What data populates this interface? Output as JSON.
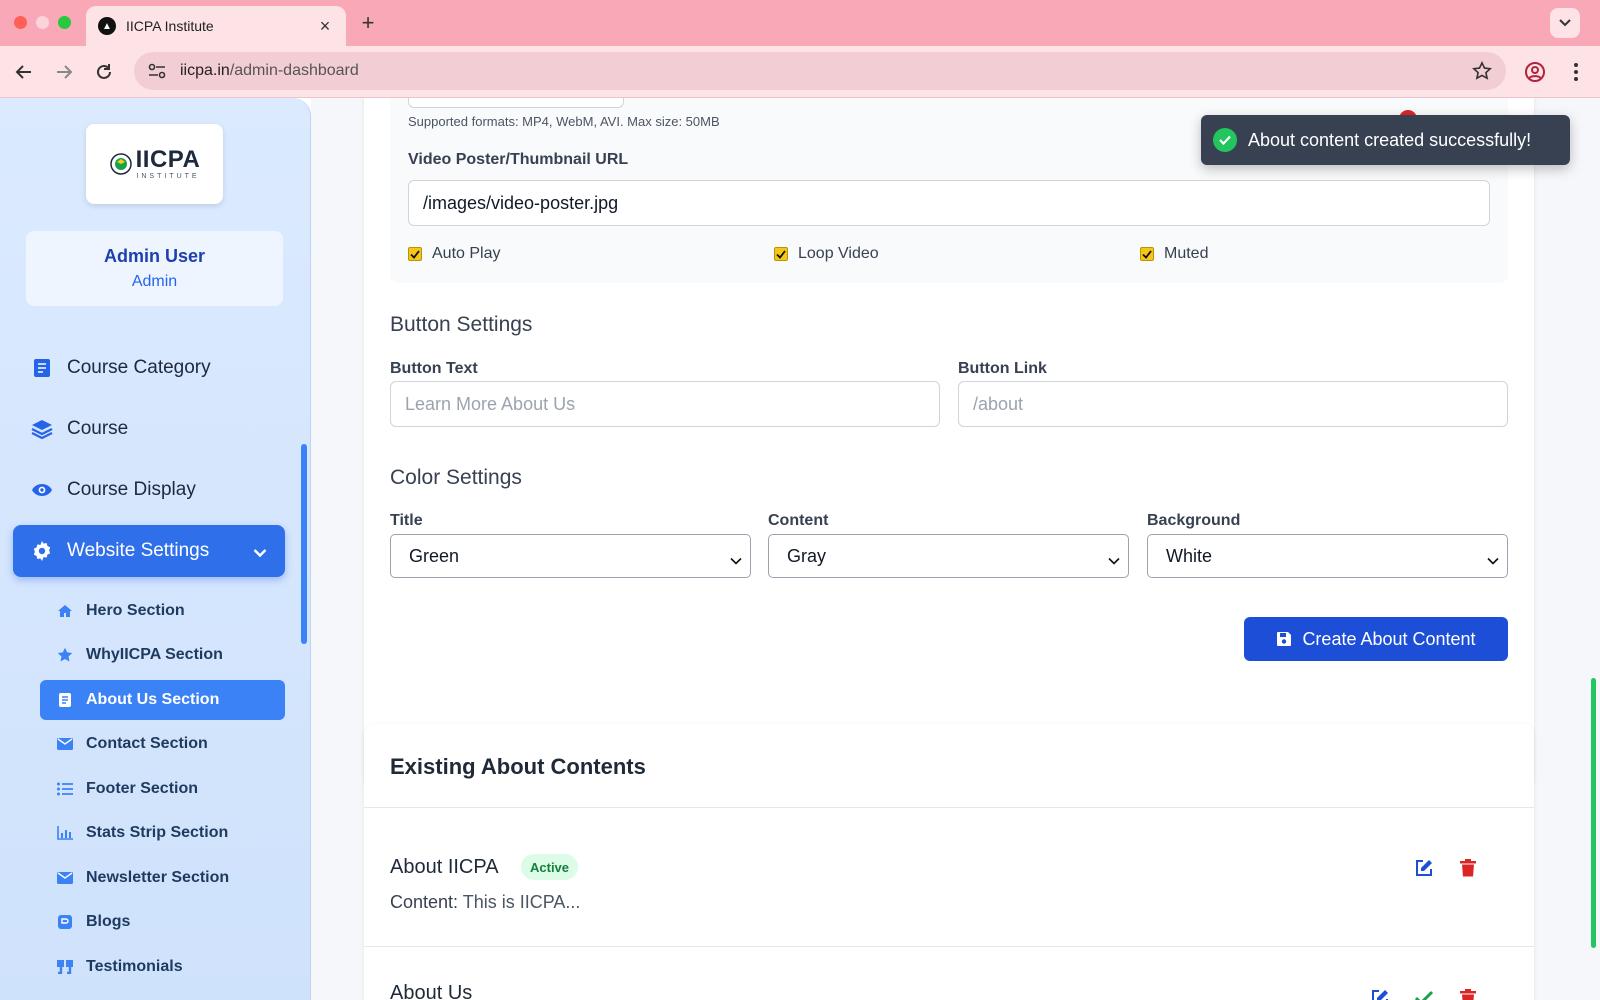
{
  "browser": {
    "tab_title": "IICPA Institute",
    "url_host": "iicpa.in",
    "url_path": "/admin-dashboard",
    "traffic_colors": [
      "#ff5f57",
      "#febc2e",
      "#28c840"
    ]
  },
  "sidebar": {
    "logo_text": "IICPA",
    "logo_sub": "INSTITUTE",
    "user_name": "Admin User",
    "user_role": "Admin",
    "nav": [
      {
        "label": "Course Category",
        "icon": "book-icon"
      },
      {
        "label": "Course",
        "icon": "layers-icon"
      },
      {
        "label": "Course Display",
        "icon": "eye-icon"
      },
      {
        "label": "Website Settings",
        "icon": "gear-icon",
        "active": true
      }
    ],
    "sub": [
      {
        "label": "Hero Section",
        "icon": "home-icon"
      },
      {
        "label": "WhyIICPA Section",
        "icon": "star-icon"
      },
      {
        "label": "About Us Section",
        "icon": "document-icon",
        "active": true
      },
      {
        "label": "Contact Section",
        "icon": "envelope-icon"
      },
      {
        "label": "Footer Section",
        "icon": "list-icon"
      },
      {
        "label": "Stats Strip Section",
        "icon": "chart-icon"
      },
      {
        "label": "Newsletter Section",
        "icon": "envelope-icon"
      },
      {
        "label": "Blogs",
        "icon": "blog-icon"
      },
      {
        "label": "Testimonials",
        "icon": "quote-icon"
      }
    ]
  },
  "form": {
    "video_hint": "Supported formats: MP4, WebM, AVI. Max size: 50MB",
    "poster_label": "Video Poster/Thumbnail URL",
    "poster_value": "/images/video-poster.jpg",
    "checkboxes": [
      {
        "label": "Auto Play",
        "checked": true
      },
      {
        "label": "Loop Video",
        "checked": true
      },
      {
        "label": "Muted",
        "checked": true
      }
    ],
    "button_settings_heading": "Button Settings",
    "button_text_label": "Button Text",
    "button_text_placeholder": "Learn More About Us",
    "button_link_label": "Button Link",
    "button_link_placeholder": "/about",
    "color_settings_heading": "Color Settings",
    "title_color_label": "Title",
    "title_color_value": "Green",
    "content_color_label": "Content",
    "content_color_value": "Gray",
    "background_color_label": "Background",
    "background_color_value": "White",
    "submit_label": "Create About Content",
    "accent": "#1d4ed8"
  },
  "existing": {
    "heading": "Existing About Contents",
    "items": [
      {
        "title": "About IICPA",
        "status": "Active",
        "content_key": "Content:",
        "content_value": " This is IICPA..."
      },
      {
        "title": "About Us"
      }
    ]
  },
  "toast": {
    "message": "About content created successfully!"
  }
}
